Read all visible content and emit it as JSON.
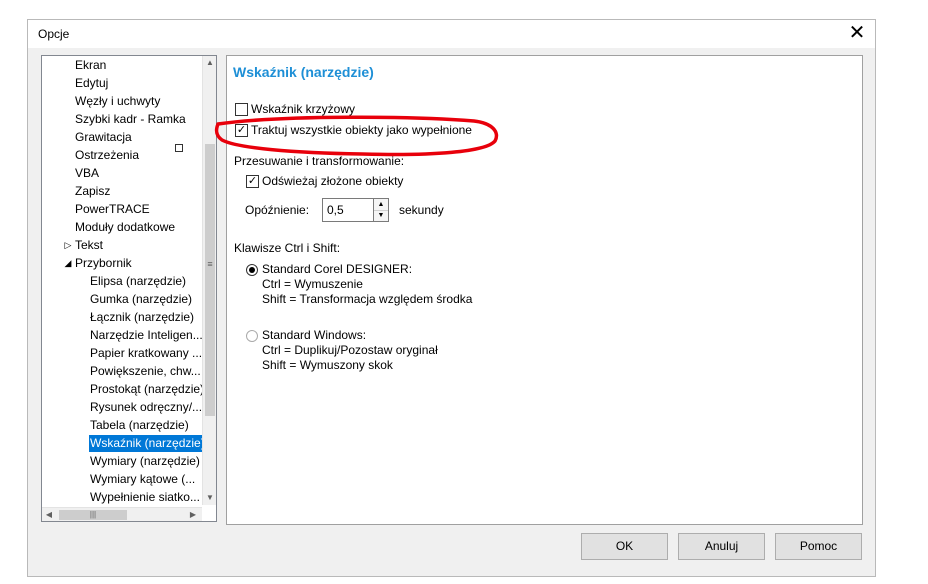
{
  "dialog": {
    "title": "Opcje"
  },
  "tree": {
    "items": [
      {
        "label": "Ekran",
        "level": 1
      },
      {
        "label": "Edytuj",
        "level": 1
      },
      {
        "label": "Węzły i uchwyty",
        "level": 1
      },
      {
        "label": "Szybki kadr - Ramka",
        "level": 1
      },
      {
        "label": "Grawitacja",
        "level": 1
      },
      {
        "label": "Ostrzeżenia",
        "level": 1
      },
      {
        "label": "VBA",
        "level": 1
      },
      {
        "label": "Zapisz",
        "level": 1
      },
      {
        "label": "PowerTRACE",
        "level": 1
      },
      {
        "label": "Moduły dodatkowe",
        "level": 1
      },
      {
        "label": "Tekst",
        "level": 1,
        "expander": "collapsed"
      },
      {
        "label": "Przybornik",
        "level": 1,
        "expander": "expanded"
      },
      {
        "label": "Elipsa (narzędzie)",
        "level": 2
      },
      {
        "label": "Gumka (narzędzie)",
        "level": 2
      },
      {
        "label": "Łącznik (narzędzie)",
        "level": 2
      },
      {
        "label": "Narzędzie Inteligen...",
        "level": 2
      },
      {
        "label": "Papier kratkowany ...",
        "level": 2
      },
      {
        "label": "Powiększenie, chw...",
        "level": 2
      },
      {
        "label": "Prostokąt (narzędzie)",
        "level": 2
      },
      {
        "label": "Rysunek odręczny/...",
        "level": 2
      },
      {
        "label": "Tabela (narzędzie)",
        "level": 2
      },
      {
        "label": "Wskaźnik (narzędzie)",
        "level": 2,
        "selected": true
      },
      {
        "label": "Wymiary (narzędzie)",
        "level": 2
      },
      {
        "label": "Wymiary kątowe (...",
        "level": 2
      },
      {
        "label": "Wypełnienie siatko...",
        "level": 2
      }
    ]
  },
  "panel": {
    "title": "Wskaźnik (narzędzie)",
    "crosshair_label": "Wskaźnik krzyżowy",
    "crosshair_checked": false,
    "treat_filled_label": "Traktuj wszystkie obiekty jako wypełnione",
    "treat_filled_checked": true,
    "move_group_label": "Przesuwanie i transformowanie:",
    "refresh_label": "Odświeżaj złożone obiekty",
    "refresh_checked": true,
    "delay_label": "Opóźnienie:",
    "delay_value": "0,5",
    "delay_unit": "sekundy",
    "keys_group_label": "Klawisze Ctrl i Shift:",
    "radio_corel": {
      "label": "Standard Corel DESIGNER:",
      "line1": "Ctrl = Wymuszenie",
      "line2": "Shift = Transformacja względem środka",
      "checked": true
    },
    "radio_windows": {
      "label": "Standard Windows:",
      "line1": "Ctrl = Duplikuj/Pozostaw oryginał",
      "line2": "Shift = Wymuszony skok",
      "checked": false
    }
  },
  "buttons": {
    "ok": "OK",
    "cancel": "Anuluj",
    "help": "Pomoc"
  },
  "icons": {
    "check": "✓",
    "close": "✕",
    "arrow_up": "▲",
    "arrow_down": "▼",
    "arrow_left": "◀",
    "arrow_right": "▶",
    "collapsed": "▷",
    "expanded": "◢"
  },
  "colors": {
    "title_blue": "#1e8fd6",
    "selection": "#0078d7",
    "annotation_red": "#e8000b"
  }
}
